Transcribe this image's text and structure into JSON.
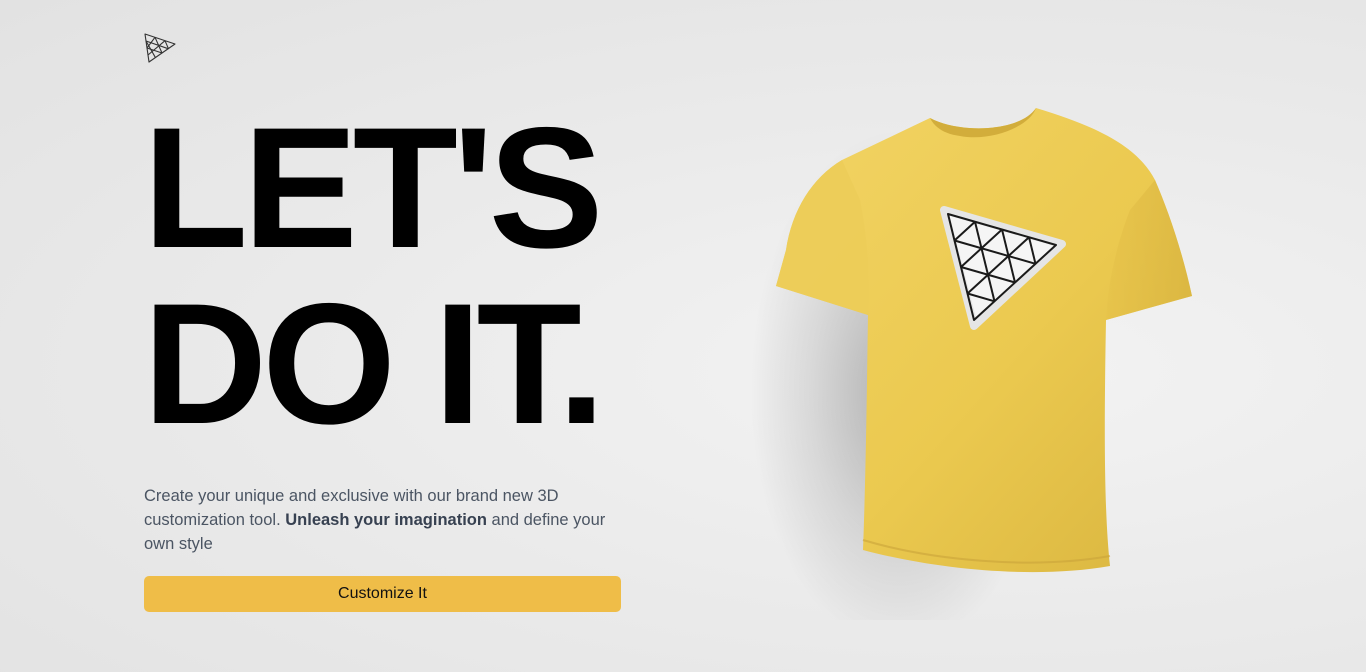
{
  "brand": {
    "logo_icon": "triangle-mesh-logo-icon"
  },
  "hero": {
    "line1": "LET'S",
    "line2": "DO IT."
  },
  "intro": {
    "text_before": "Create your unique and exclusive with our brand new 3D customization tool. ",
    "text_bold": "Unleash your imagination",
    "text_after": " and define your own style"
  },
  "cta": {
    "label": "Customize It",
    "color": "#efbd48"
  },
  "shirt": {
    "color": "#efcf5a",
    "decal_icon": "triangle-mesh-decal-icon"
  }
}
